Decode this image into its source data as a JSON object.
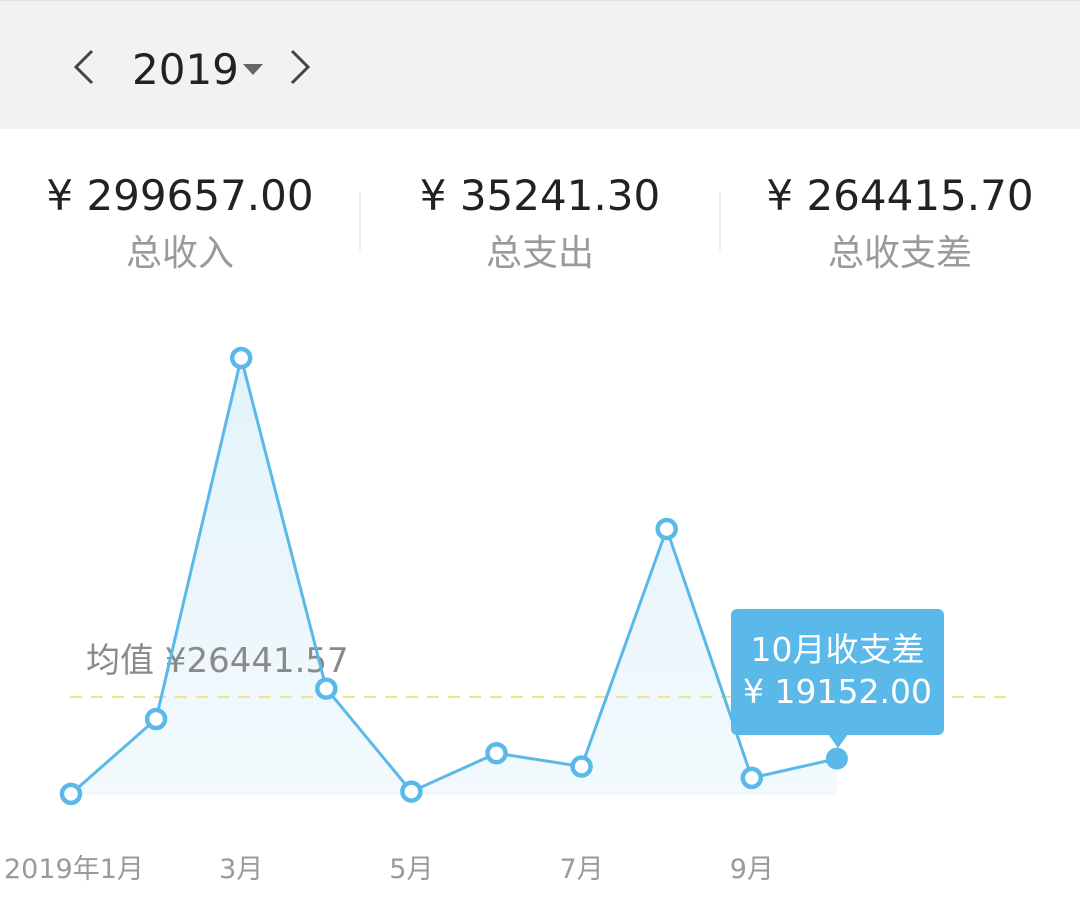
{
  "header": {
    "year": "2019",
    "prev_icon": "chevron-left-icon",
    "next_icon": "chevron-right-icon",
    "dropdown_icon": "caret-down-icon"
  },
  "summary": [
    {
      "amount": "¥ 299657.00",
      "label": "总收入"
    },
    {
      "amount": "¥ 35241.30",
      "label": "总支出"
    },
    {
      "amount": "¥ 264415.70",
      "label": "总收支差"
    }
  ],
  "chart_data": {
    "type": "area",
    "x_tick_labels": [
      "2019年1月",
      "3月",
      "5月",
      "7月",
      "9月"
    ],
    "x": [
      1,
      2,
      3,
      4,
      5,
      6,
      7,
      8,
      9,
      10
    ],
    "series": [
      {
        "values": [
          600,
          40000,
          230000,
          56000,
          1800,
          22000,
          15000,
          140000,
          9000,
          19152
        ]
      }
    ],
    "average": 26441.57,
    "average_label": "均值 ¥26441.57",
    "ylim": [
      0,
      240000
    ],
    "tooltip": {
      "title": "10月收支差",
      "value": "¥ 19152.00",
      "index": 9
    },
    "colors": {
      "line": "#5ab9e8",
      "fill": "#e3f3fb",
      "average_line": "#f1e58a"
    }
  }
}
